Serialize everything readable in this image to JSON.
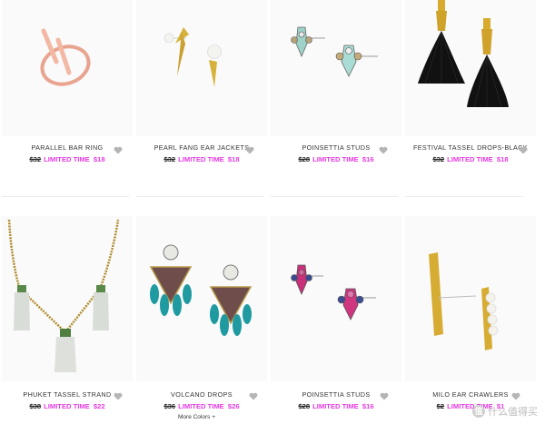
{
  "products": [
    {
      "title": "PARALLEL BAR RING",
      "old_price": "$32",
      "promo": "LIMITED TIME",
      "new_price": "$18"
    },
    {
      "title": "PEARL FANG EAR JACKETS",
      "old_price": "$32",
      "promo": "LIMITED TIME",
      "new_price": "$18"
    },
    {
      "title": "POINSETTIA STUDS",
      "old_price": "$28",
      "promo": "LIMITED TIME",
      "new_price": "$16"
    },
    {
      "title": "FESTIVAL TASSEL DROPS-BLACK",
      "old_price": "$32",
      "promo": "LIMITED TIME",
      "new_price": "$18"
    },
    {
      "title": "PHUKET TASSEL STRAND",
      "old_price": "$38",
      "promo": "LIMITED TIME",
      "new_price": "$22"
    },
    {
      "title": "VOLCANO DROPS",
      "old_price": "$36",
      "promo": "LIMITED TIME",
      "new_price": "$26"
    },
    {
      "title": "POINSETTIA STUDS",
      "old_price": "$28",
      "promo": "LIMITED TIME",
      "new_price": "$16"
    },
    {
      "title": "MILO EAR CRAWLERS",
      "old_price": "$2",
      "promo": "LIMITED TIME",
      "new_price": "$1"
    }
  ],
  "more_colors": "More Colors +",
  "watermark": "什么值得买",
  "watermark_badge": "值",
  "colors": {
    "promo": "#e63be0",
    "heart": "#b5b5b5"
  }
}
